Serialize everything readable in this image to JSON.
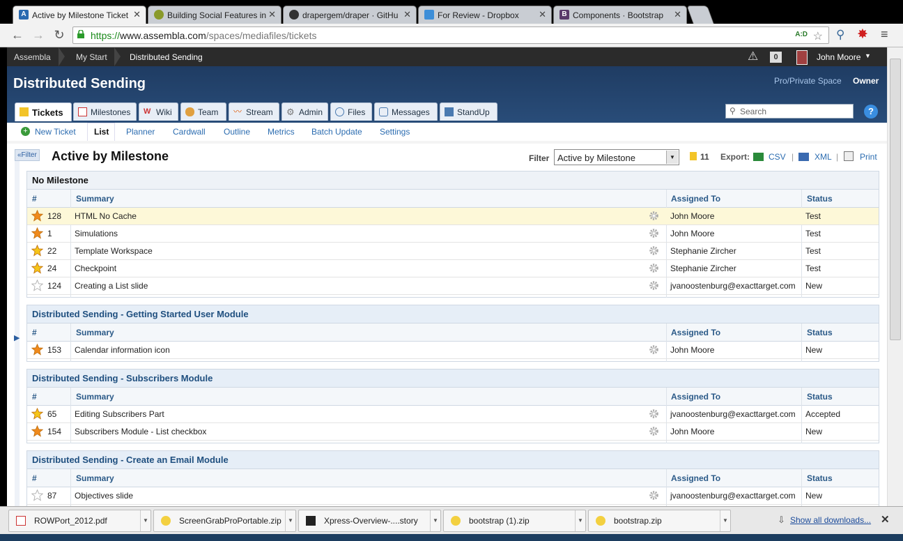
{
  "browser": {
    "tabs": [
      {
        "title": "Active by Milestone Ticket",
        "favicon": "assembla-icon"
      },
      {
        "title": "Building Social Features in",
        "favicon": "owl-icon"
      },
      {
        "title": "drapergem/draper · GitHu",
        "favicon": "github-icon"
      },
      {
        "title": "For Review - Dropbox",
        "favicon": "dropbox-icon"
      },
      {
        "title": "Components · Bootstrap",
        "favicon": "bootstrap-icon"
      }
    ],
    "url_prefix": "https://",
    "url_host": "www.assembla.com",
    "url_path": "/spaces/mediafiles/tickets"
  },
  "topbar": {
    "breadcrumbs": [
      "Assembla",
      "My Start",
      "Distributed Sending"
    ],
    "alert_count": "0",
    "user_name": "John Moore"
  },
  "header": {
    "space_title": "Distributed Sending",
    "space_type": "Pro/Private Space",
    "role": "Owner",
    "search_placeholder": "Search",
    "tabs": [
      "Tickets",
      "Milestones",
      "Wiki",
      "Team",
      "Stream",
      "Admin",
      "Files",
      "Messages",
      "StandUp"
    ]
  },
  "subnav": {
    "new_ticket": "New Ticket",
    "links": [
      "List",
      "Planner",
      "Cardwall",
      "Outline",
      "Metrics",
      "Batch Update",
      "Settings"
    ]
  },
  "view": {
    "filter_toggle": "«Filter",
    "title": "Active by Milestone",
    "filter_label": "Filter",
    "filter_value": "Active by Milestone",
    "count": "11",
    "export_label": "Export:",
    "csv": "CSV",
    "xml": "XML",
    "print": "Print"
  },
  "columns": {
    "num": "#",
    "summary": "Summary",
    "assigned": "Assigned To",
    "status": "Status"
  },
  "groups": [
    {
      "name": "No Milestone",
      "tickets": [
        {
          "id": "128",
          "summary": "HTML No Cache",
          "assigned": "John Moore",
          "status": "Test",
          "star": "orange"
        },
        {
          "id": "1",
          "summary": "Simulations",
          "assigned": "John Moore",
          "status": "Test",
          "star": "orange"
        },
        {
          "id": "22",
          "summary": "Template Workspace",
          "assigned": "Stephanie Zircher",
          "status": "Test",
          "star": "yellow"
        },
        {
          "id": "24",
          "summary": "Checkpoint",
          "assigned": "Stephanie Zircher",
          "status": "Test",
          "star": "yellow"
        },
        {
          "id": "124",
          "summary": "Creating a List slide",
          "assigned": "jvanoostenburg@exacttarget.com",
          "status": "New",
          "star": "empty"
        }
      ]
    },
    {
      "name": "Distributed Sending - Getting Started User Module",
      "tickets": [
        {
          "id": "153",
          "summary": "Calendar information icon",
          "assigned": "John Moore",
          "status": "New",
          "star": "orange"
        }
      ]
    },
    {
      "name": "Distributed Sending - Subscribers Module",
      "tickets": [
        {
          "id": "65",
          "summary": "Editing Subscribers Part",
          "assigned": "jvanoostenburg@exacttarget.com",
          "status": "Accepted",
          "star": "yellow"
        },
        {
          "id": "154",
          "summary": "Subscribers Module - List checkbox",
          "assigned": "John Moore",
          "status": "New",
          "star": "orange"
        }
      ]
    },
    {
      "name": "Distributed Sending - Create an Email Module",
      "tickets": [
        {
          "id": "87",
          "summary": "Objectives slide",
          "assigned": "jvanoostenburg@exacttarget.com",
          "status": "New",
          "star": "empty"
        }
      ]
    }
  ],
  "downloads": {
    "items": [
      "ROWPort_2012.pdf",
      "ScreenGrabProPortable.zip",
      "Xpress-Overview-....story",
      "bootstrap (1).zip",
      "bootstrap.zip"
    ],
    "show_all": "Show all downloads..."
  },
  "colors": {
    "star_orange": "#f08a1c",
    "star_yellow": "#f5c518",
    "header": "#244873",
    "link": "#2b6cb0"
  }
}
